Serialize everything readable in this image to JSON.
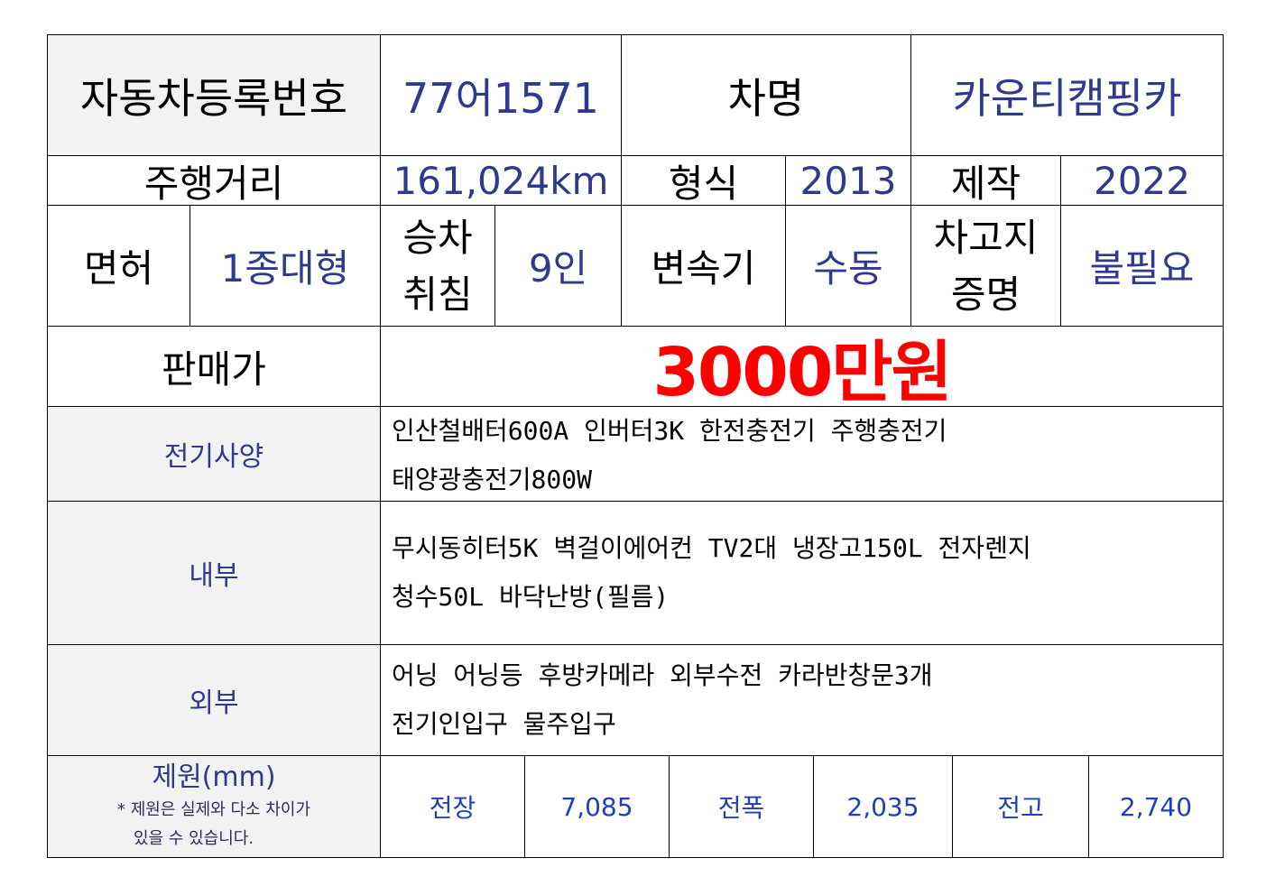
{
  "row1": {
    "reg_label": "자동차등록번호",
    "reg_value": "77어1571",
    "name_label": "차명",
    "name_value": "카운티캠핑카"
  },
  "row2": {
    "mileage_label": "주행거리",
    "mileage_value": "161,024km",
    "model_label": "형식",
    "model_value": "2013",
    "made_label": "제작",
    "made_value": "2022"
  },
  "row3": {
    "license_label": "면허",
    "license_value": "1종대형",
    "seats_label_1": "승차",
    "seats_label_2": "취침",
    "seats_value": "9인",
    "trans_label": "변속기",
    "trans_value": "수동",
    "garage_label_1": "차고지",
    "garage_label_2": "증명",
    "garage_value": "불필요"
  },
  "price": {
    "label": "판매가",
    "value": "3000만원"
  },
  "electric": {
    "label": "전기사양",
    "line1": "인산철배터600A 인버터3K 한전충전기 주행충전기",
    "line2": "태양광충전기800W"
  },
  "interior": {
    "label": "내부",
    "line1": "무시동히터5K 벽걸이에어컨 TV2대 냉장고150L 전자렌지",
    "line2": "청수50L 바닥난방(필름)"
  },
  "exterior": {
    "label": "외부",
    "line1": "어닝 어닝등 후방카메라 외부수전 카라반창문3개",
    "line2": "전기인입구 물주입구"
  },
  "specs": {
    "label": "제원(mm)",
    "note_1": "* 제원은 실제와 다소 차이가",
    "note_2": "있을 수 있습니다.",
    "length_label": "전장",
    "length_value": "7,085",
    "width_label": "전폭",
    "width_value": "2,035",
    "height_label": "전고",
    "height_value": "2,740"
  },
  "colors": {
    "label_bg": "#f2f2f2",
    "value_text": "#2f3a8f",
    "price_text": "#ff0000",
    "spec_text": "#1f3fbf"
  }
}
